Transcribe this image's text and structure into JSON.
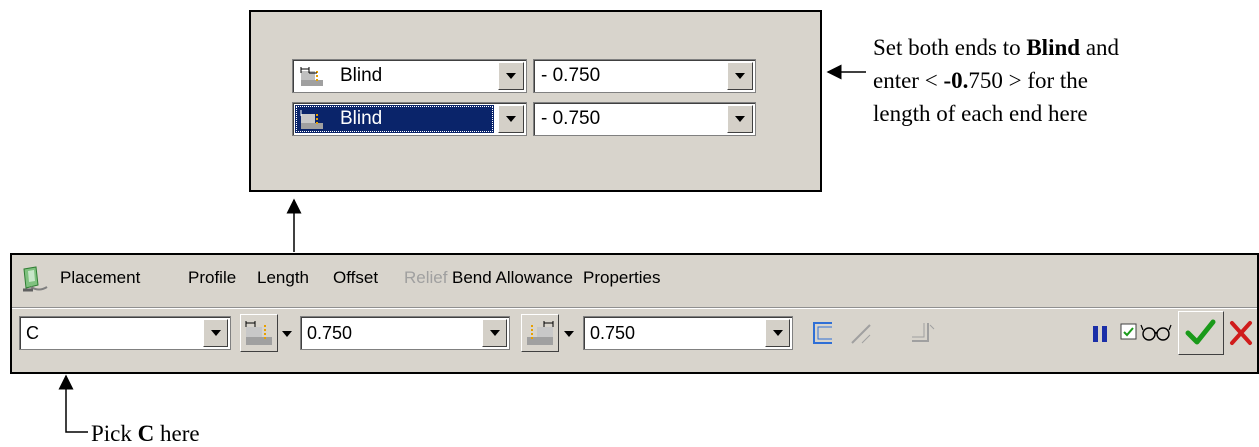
{
  "callout_panel": {
    "side1": {
      "depth_option": "Blind",
      "value": "- 0.750"
    },
    "side2": {
      "depth_option": "Blind",
      "value": "- 0.750",
      "selected": true
    }
  },
  "annotation_top": {
    "line1_pre": "Set both ends to ",
    "line1_bold": "Blind",
    "line1_post": " and",
    "line2_pre": "enter < ",
    "line2_bold": "-0.",
    "line2_post": "750 > for the",
    "line3": "length of each end here"
  },
  "annotation_bottom": {
    "pre": "Pick ",
    "bold": "C",
    "post": " here"
  },
  "dashboard": {
    "menu": [
      "Placement",
      "Profile",
      "Length",
      "Offset",
      "Relief",
      "Bend Allowance",
      "Properties"
    ],
    "disabled_menu": "Relief",
    "shape_value": "C",
    "length1": "0.750",
    "length2": "0.750"
  },
  "colors": {
    "panel_bg": "#d8d4cc",
    "selection": "#0a246a",
    "pause": "#1b2fa8",
    "ok_check": "#1a9a1a",
    "cancel_x": "#d01c1c"
  },
  "icons": [
    "depth-blind-icon",
    "dropdown-arrow-icon",
    "app-feature-icon",
    "profile-side-icon",
    "miter-icon",
    "relief-icon",
    "pause-icon",
    "preview-glasses-icon",
    "checkmark-icon",
    "close-icon"
  ]
}
